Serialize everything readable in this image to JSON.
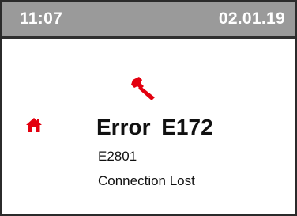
{
  "status_bar": {
    "time": "11:07",
    "date": "02.01.19"
  },
  "error": {
    "title": "Error  E172",
    "code": "E2801",
    "message": "Connection Lost"
  },
  "icons": {
    "status_icon": "wrench-icon",
    "nav_icon": "home-icon"
  },
  "colors": {
    "accent": "#e3000f",
    "status_bar_bg": "#9a9a9a",
    "status_text": "#ffffff"
  }
}
